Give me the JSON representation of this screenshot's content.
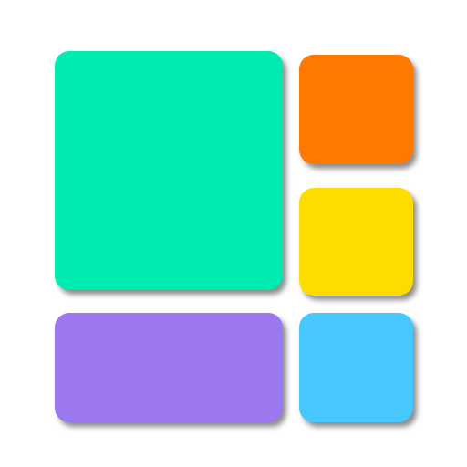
{
  "app_icon": {
    "tiles": [
      {
        "id": "large",
        "color": "#00EBAF"
      },
      {
        "id": "top-right",
        "color": "#FF7800"
      },
      {
        "id": "middle-right",
        "color": "#FFDC00"
      },
      {
        "id": "wide-bottom",
        "color": "#9B78F0"
      },
      {
        "id": "bottom-right",
        "color": "#46C8FF"
      }
    ]
  }
}
